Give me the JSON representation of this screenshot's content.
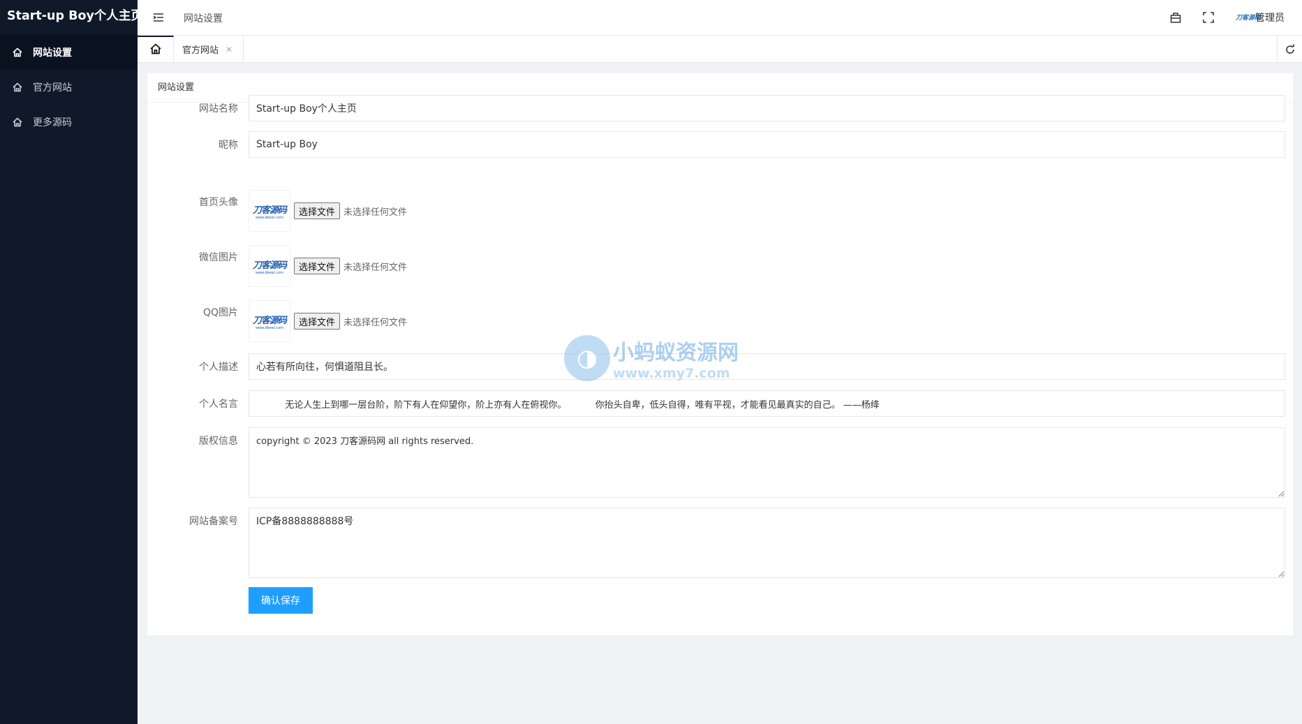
{
  "app": {
    "logo": "Start-up Boy个人主页"
  },
  "sidebar": {
    "items": [
      {
        "label": "网站设置",
        "icon": "home-icon",
        "active": true
      },
      {
        "label": "官方网站",
        "icon": "home-icon",
        "active": false
      },
      {
        "label": "更多源码",
        "icon": "home-icon",
        "active": false
      }
    ]
  },
  "header": {
    "title": "网站设置",
    "admin_brand": "刀客源码",
    "admin_label": "管理员"
  },
  "tabs": {
    "items": [
      {
        "label": "官方网站",
        "closable": true
      }
    ]
  },
  "card": {
    "title": "网站设置",
    "fields": {
      "site_name": {
        "label": "网站名称",
        "value": "Start-up Boy个人主页"
      },
      "nickname": {
        "label": "昵称",
        "value": "Start-up Boy"
      },
      "avatar": {
        "label": "首页头像",
        "button": "选择文件",
        "status": "未选择任何文件",
        "thumb_text": "刀客源码",
        "thumb_sub": "www.dkewl.com"
      },
      "wechat": {
        "label": "微信图片",
        "button": "选择文件",
        "status": "未选择任何文件",
        "thumb_text": "刀客源码",
        "thumb_sub": "www.dkewl.com"
      },
      "qq": {
        "label": "QQ图片",
        "button": "选择文件",
        "status": "未选择任何文件",
        "thumb_text": "刀客源码",
        "thumb_sub": "www.dkewl.com"
      },
      "description": {
        "label": "个人描述",
        "value": "心若有所向往，何惧道阻且长。"
      },
      "motto": {
        "label": "个人名言",
        "value": "          无论人生上到哪一层台阶，阶下有人在仰望你，阶上亦有人在俯视你。          你抬头自卑，低头自得，唯有平视，才能看见最真实的自己。 ——杨绛"
      },
      "copyright": {
        "label": "版权信息",
        "value": "copyright © 2023 刀客源码网 all rights reserved."
      },
      "icp": {
        "label": "网站备案号",
        "value": "ICP备8888888888号"
      }
    },
    "save_label": "确认保存"
  },
  "watermark": {
    "cn": "小蚂蚁资源网",
    "url": "www.xmy7.com"
  },
  "colors": {
    "sidebar_bg": "#10192a",
    "primary": "#1e9fff",
    "page_bg": "#f0f2f5"
  }
}
